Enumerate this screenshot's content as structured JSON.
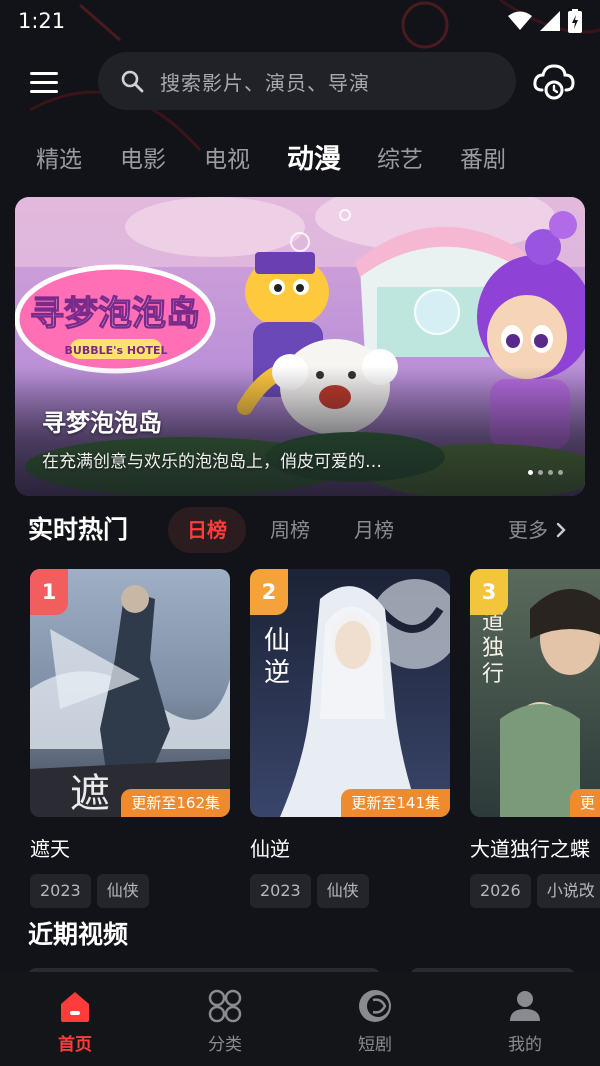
{
  "status_bar": {
    "time": "1:21"
  },
  "search": {
    "placeholder": "搜索影片、演员、导演"
  },
  "tabs": [
    "精选",
    "电影",
    "电视",
    "动漫",
    "综艺",
    "番剧"
  ],
  "active_tab": "动漫",
  "banner": {
    "title": "寻梦泡泡岛",
    "description": "在充满创意与欢乐的泡泡岛上，俏皮可爱的…",
    "logo_text": "寻梦泡泡岛",
    "logo_subtext": "BUBBLE's HOTEL",
    "page_count": 4,
    "current_page": 1
  },
  "hot": {
    "title": "实时热门",
    "rank_tabs": [
      "日榜",
      "周榜",
      "月榜"
    ],
    "active_rank_tab": "日榜",
    "more_label": "更多",
    "items": [
      {
        "rank": "1",
        "title": "遮天",
        "update": "更新至162集",
        "tags": [
          "2023",
          "仙侠"
        ],
        "badge_color": "#f25d5d"
      },
      {
        "rank": "2",
        "title": "仙逆",
        "update": "更新至141集",
        "tags": [
          "2023",
          "仙侠"
        ],
        "badge_color": "#f5a23a"
      },
      {
        "rank": "3",
        "title": "大道独行之蝶",
        "update": "更",
        "tags": [
          "2026",
          "小说改"
        ],
        "badge_color": "#f2c53b"
      }
    ]
  },
  "recent": {
    "title": "近期视频"
  },
  "bottom_nav": [
    {
      "label": "首页",
      "icon": "home-icon",
      "active": true
    },
    {
      "label": "分类",
      "icon": "category-icon",
      "active": false
    },
    {
      "label": "短剧",
      "icon": "short-drama-icon",
      "active": false
    },
    {
      "label": "我的",
      "icon": "profile-icon",
      "active": false
    }
  ],
  "colors": {
    "accent": "#ff3b3b",
    "background": "#121318",
    "update_badge": "#f08a2e"
  }
}
